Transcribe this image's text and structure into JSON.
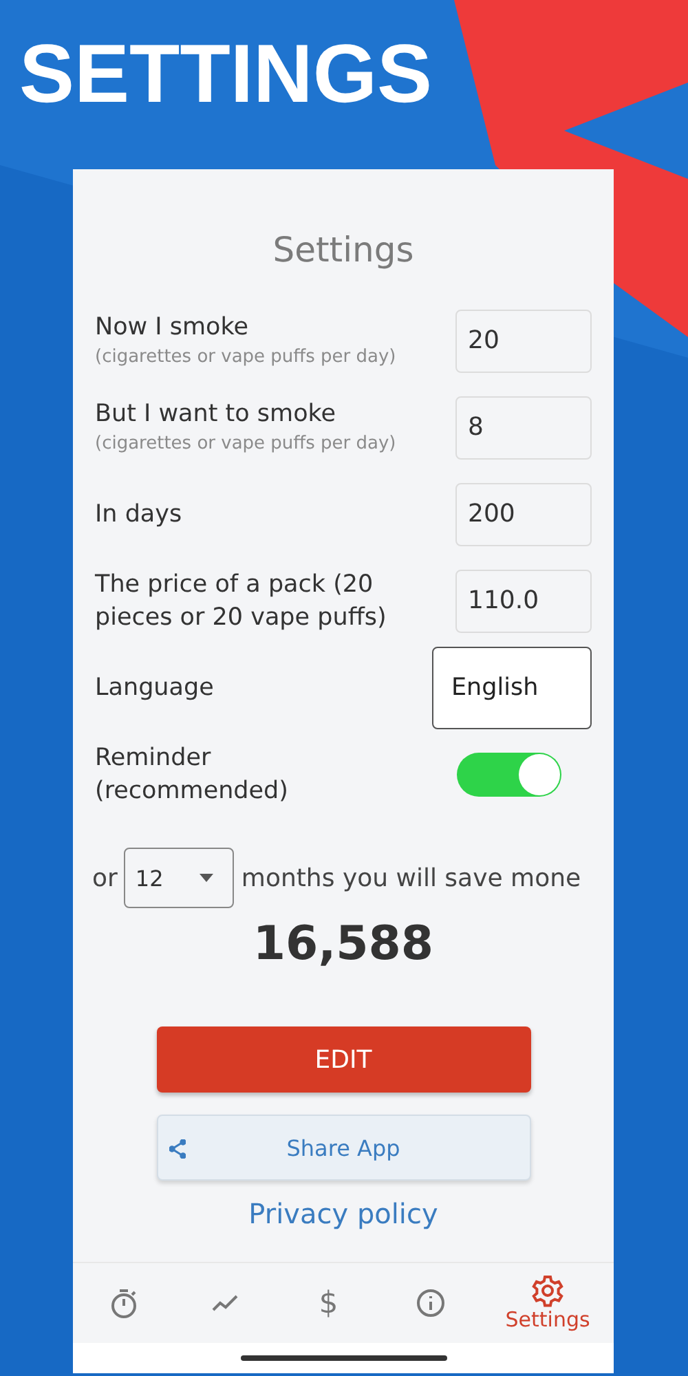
{
  "banner": {
    "headline": "SETTINGS"
  },
  "screen": {
    "title": "Settings"
  },
  "fields": [
    {
      "kind": "number",
      "label": "Now I smoke",
      "hint": "(cigarettes or vape puffs per day)",
      "value": "20"
    },
    {
      "kind": "number",
      "label": "But I want to smoke",
      "hint": "(cigarettes or vape puffs per day)",
      "value": "8"
    },
    {
      "kind": "number",
      "label": "In days",
      "value": "200"
    },
    {
      "kind": "number",
      "label": "The price of a pack (20 pieces or 20 vape puffs)",
      "value": "110.0"
    },
    {
      "kind": "picker",
      "label": "Language",
      "value": "English"
    },
    {
      "kind": "toggle",
      "label": "Reminder (recommended)",
      "on": true
    }
  ],
  "savings": {
    "prefix": "or",
    "months": "12",
    "suffix": "months you will save mone",
    "amount": "16,588"
  },
  "edit_button": "EDIT",
  "share_button": "Share App",
  "privacy_link": "Privacy policy",
  "nav": [
    {
      "kind": "timer",
      "selected": false
    },
    {
      "kind": "chart",
      "selected": false
    },
    {
      "kind": "glyph",
      "glyph": "$",
      "selected": false
    },
    {
      "kind": "info",
      "selected": false
    },
    {
      "kind": "gear",
      "label": "Settings",
      "selected": true
    }
  ]
}
